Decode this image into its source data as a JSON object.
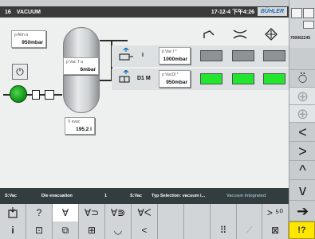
{
  "header": {
    "screen_number": "16",
    "title": "VACUUM",
    "datetime": "17-12-4 下午4:26",
    "brand": "BÜHLER"
  },
  "values": {
    "p_atm": {
      "label": "p Atm    a",
      "value": "950mbar"
    },
    "p_vac_t": {
      "label": "p Vac T  a",
      "value": "6mbar"
    },
    "v_evac": {
      "label": "V evac",
      "value": "195.2   l"
    },
    "p_vac_i": {
      "label": "p Vac I  *",
      "value": "1000mbar"
    },
    "p_vac_di": {
      "label": "p VacDI  *",
      "value": "950mbar"
    }
  },
  "rows": [
    {
      "label": "I",
      "cells": [
        "grey",
        "grey",
        "grey"
      ]
    },
    {
      "label": "D1 M",
      "cells": [
        "green",
        "green",
        "green"
      ]
    }
  ],
  "column_icons": [
    "ejector-icon",
    "clamp-icon",
    "diamond-cross-icon"
  ],
  "status": {
    "left": "S:Vac",
    "mode": "Die evacuation",
    "num": "1",
    "sel_label": "S:Vac",
    "selection": "Typ Selection: vacuum i...",
    "extra": "Vacuum integrated"
  },
  "toolbar1": {
    "items": [
      "machine-icon",
      "?",
      "∀",
      "∀⊃",
      "∀⋑",
      "∀ᐸ",
      "",
      "",
      "",
      "",
      "> ⁵⁰",
      "⚡"
    ]
  },
  "toolbar2": {
    "items": [
      "i",
      "clamp-icon",
      "unit-icon",
      "mold-icon",
      "cup-icon",
      "ladle-icon",
      "",
      "",
      "",
      "robot-icon",
      "ejector-icon",
      "lock-icon"
    ]
  },
  "rail": {
    "code": "700062245",
    "arrows": [
      "<",
      ">",
      "^",
      "v"
    ]
  },
  "help": {
    "label": "!?"
  }
}
